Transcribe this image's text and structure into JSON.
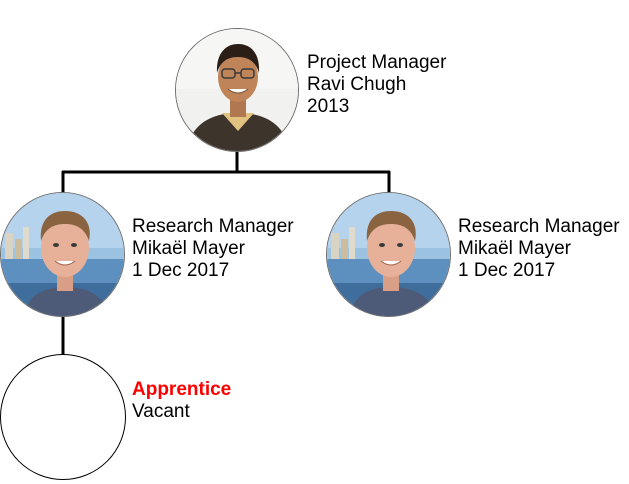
{
  "nodes": {
    "root": {
      "title": "Project Manager",
      "name": "Ravi Chugh",
      "date": "2013"
    },
    "child_left": {
      "title": "Research Manager",
      "name": "Mikaël Mayer",
      "date": "1 Dec 2017"
    },
    "child_right": {
      "title": "Research Manager",
      "name": "Mikaël Mayer",
      "date": "1 Dec 2017"
    },
    "grandchild": {
      "title": "Apprentice",
      "name": "Vacant"
    }
  },
  "colors": {
    "vacant_title": "#ff0000",
    "connector": "#000000"
  }
}
